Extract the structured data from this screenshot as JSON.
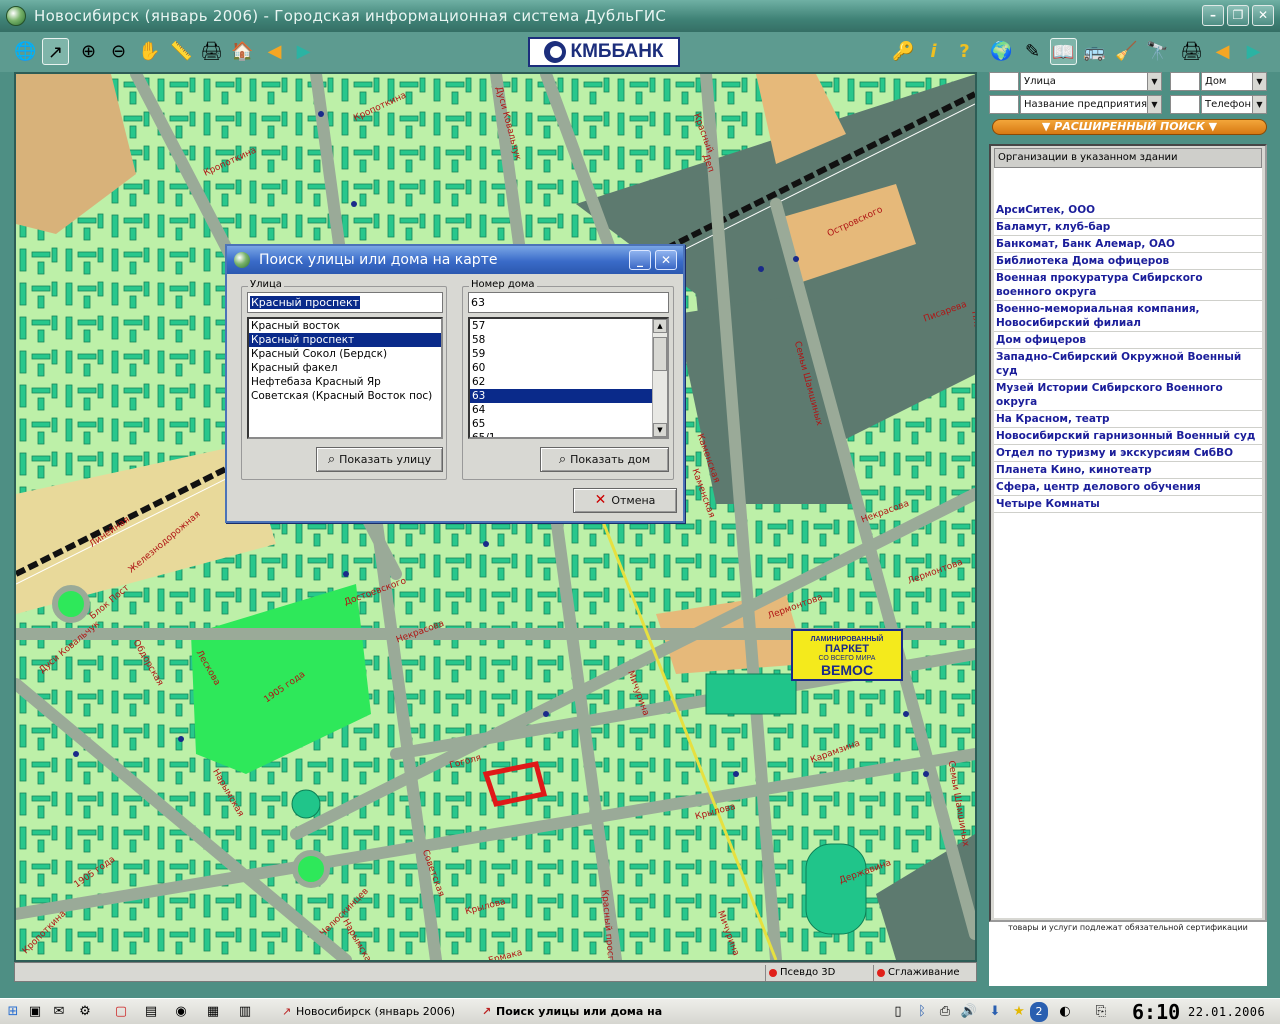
{
  "window": {
    "title": "Новосибирск (январь 2006) - Городская информационная система ДубльГИС"
  },
  "toolbar": {
    "left_icons": [
      "globe-icon",
      "pointer-icon",
      "zoom-in-icon",
      "zoom-out-icon",
      "hand-pan-icon",
      "ruler-icon",
      "print-icon",
      "home-icon",
      "back-arrow-icon",
      "forward-arrow-icon"
    ],
    "banner": "КМББАНК",
    "right_icons": [
      "key-icon",
      "info-icon",
      "help-icon",
      "globe-search-icon",
      "pencil-icon",
      "folder-icon",
      "bus-icon",
      "broom-icon",
      "binoculars-icon",
      "print-icon",
      "back-arrow-icon",
      "forward-arrow-icon"
    ]
  },
  "search_fields": {
    "street": "Улица",
    "house": "Дом",
    "company": "Название предприятия",
    "phone": "Телефон",
    "extended_search": "РАСШИРЕННЫЙ ПОИСК"
  },
  "org_panel": {
    "header": "Организации в указанном здании",
    "items": [
      "АрсиСитек, ООО",
      "Баламут, клуб-бар",
      "Банкомат, Банк Алемар, ОАО",
      "Библиотека Дома офицеров",
      "Военная прокуратура Сибирского военного округа",
      "Военно-мемориальная компания, Новосибирский филиал",
      "Дом офицеров",
      "Западно-Сибирский Окружной Военный суд",
      "Музей Истории Сибирского Военного округа",
      "На Красном, театр",
      "Новосибирский гарнизонный Военный суд",
      "Отдел по туризму и экскурсиям СибВО",
      "Планета Кино, кинотеатр",
      "Сфера, центр делового обучения",
      "Четыре Комнаты"
    ],
    "note": "товары и услуги подлежат обязательной сертификации"
  },
  "dialog": {
    "title": "Поиск улицы или дома на карте",
    "street_group_label": "Улица",
    "street_input": "Красный проспект",
    "street_options": [
      "Красный восток",
      "Красный проспект",
      "Красный Сокол (Бердск)",
      "Красный факел",
      "Нефтебаза Красный Яр",
      "Советская (Красный Восток пос)"
    ],
    "street_selected": "Красный проспект",
    "house_group_label": "Номер дома",
    "house_input": "63",
    "house_options": [
      "57",
      "58",
      "59",
      "60",
      "62",
      "63",
      "64",
      "65",
      "65/1"
    ],
    "house_selected": "63",
    "show_street": "Показать улицу",
    "show_house": "Показать дом",
    "cancel": "Отмена"
  },
  "map": {
    "street_labels": [
      "Кропоткина",
      "Кропоткина",
      "Дуси Ковальчук",
      "Линейная",
      "Островского",
      "Линейная",
      "Железнодорожная",
      "Блок Пост",
      "Дуси Ковальчук",
      "Обдорская",
      "Лескова",
      "1905 года",
      "Нарымская",
      "1905 года",
      "Семьи Шамшиных",
      "Каменская",
      "Некрасова",
      "Лермонтова",
      "Мичурина",
      "Гоголя",
      "Советская",
      "Крылова",
      "Ермака",
      "Красный проспект",
      "Мичурина",
      "Каменская",
      "Державина",
      "Крылова",
      "Лермонтова",
      "Семьи Шамшиных",
      "Достоевского",
      "Некрасова",
      "Карамзина",
      "Писарева",
      "Ельцовская",
      "Челюскинцев",
      "Нарымская",
      "Кропоткина",
      "Плановая",
      "Деп",
      "Красный"
    ],
    "ad": {
      "line1": "ЛАМИНИРОВАННЫЙ",
      "line2": "ПАРКЕТ",
      "line3": "СО ВСЕГО МИРА",
      "line4": "ВЕМОС"
    }
  },
  "status": {
    "pseudo3d": "Псевдо 3D",
    "smoothing": "Сглаживание"
  },
  "taskbar": {
    "tasks": [
      "Новосибирск (январь 2006)",
      "Поиск улицы или дома на"
    ],
    "tray_count": "2",
    "clock": "6:10",
    "date": "22.01.2006"
  },
  "colors": {
    "map_block_bg": "#bdf0a8",
    "building": "#20c58a",
    "building_edge": "#0c7f55",
    "title_bar": "#3f8276",
    "dialog_title": "#3a6bc8",
    "selection": "#0a2a8a",
    "org_link": "#1a1d9a"
  }
}
